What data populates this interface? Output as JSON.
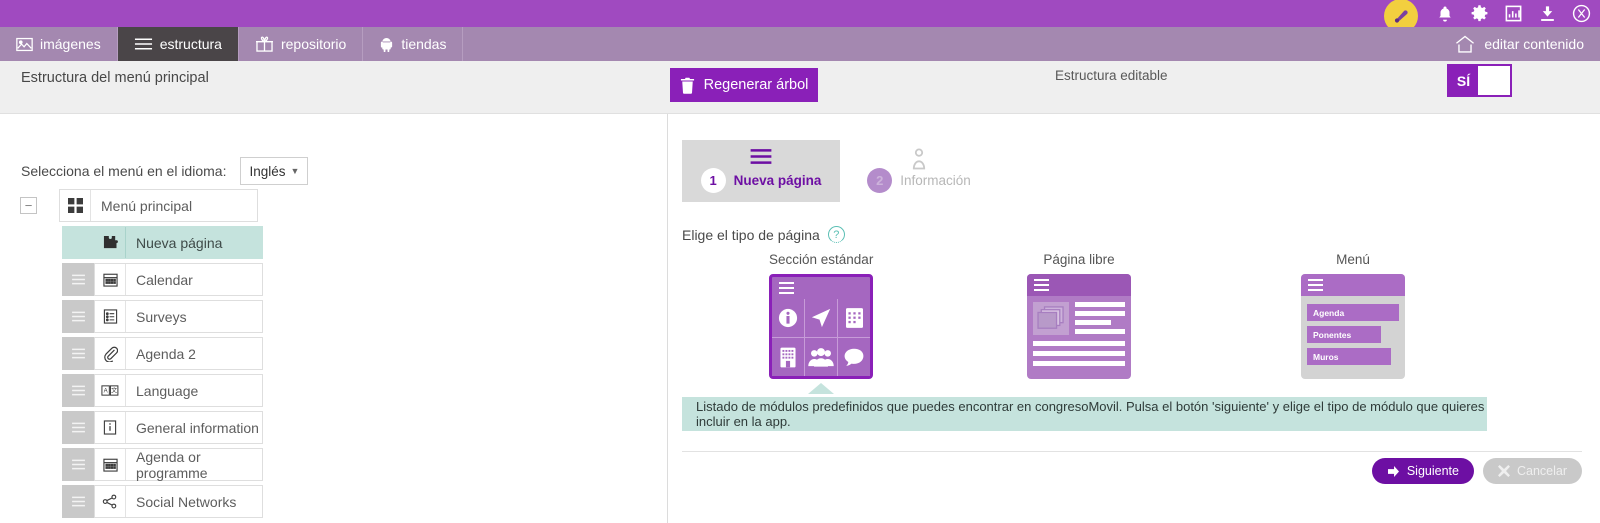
{
  "topbar": {
    "accent_color": "#a04ac0",
    "avatar_color": "#f2cf3f",
    "icons": [
      "avatar-icon",
      "bell-icon",
      "gear-icon",
      "stats-icon",
      "download-icon",
      "android-icon"
    ]
  },
  "nav": {
    "tabs": [
      {
        "label": "imágenes",
        "icon": "image-icon",
        "active": false
      },
      {
        "label": "estructura",
        "icon": "menu-icon",
        "active": true
      },
      {
        "label": "repositorio",
        "icon": "gift-icon",
        "active": false
      },
      {
        "label": "tiendas",
        "icon": "android-icon",
        "active": false
      }
    ],
    "right_link": {
      "label": "editar contenido",
      "icon": "home-icon"
    }
  },
  "subheader": {
    "title": "Estructura del menú principal",
    "regenerate_button": {
      "label": "Regenerar árbol",
      "icon": "trash-icon"
    },
    "editable_label": "Estructura editable",
    "toggle": {
      "value": "SÍ",
      "state": "on"
    }
  },
  "left_panel": {
    "language_label": "Selecciona el menú en el idioma:",
    "language_value": "Inglés",
    "tree": {
      "root": {
        "label": "Menú principal",
        "icon": "grid-icon",
        "collapse": "−"
      },
      "children": [
        {
          "label": "Nueva página",
          "icon": "puzzle-icon",
          "selected": true
        },
        {
          "label": "Calendar",
          "icon": "calendar-icon",
          "selected": false
        },
        {
          "label": "Surveys",
          "icon": "survey-icon",
          "selected": false
        },
        {
          "label": "Agenda 2",
          "icon": "paperclip-icon",
          "selected": false
        },
        {
          "label": "Language",
          "icon": "translate-icon",
          "selected": false
        },
        {
          "label": "General information",
          "icon": "info-icon",
          "selected": false
        },
        {
          "label": "Agenda or programme",
          "icon": "calendar-icon",
          "selected": false
        },
        {
          "label": "Social Networks",
          "icon": "share-icon",
          "selected": false
        }
      ]
    }
  },
  "right_panel": {
    "steps": [
      {
        "num": "1",
        "label": "Nueva página",
        "icon": "menu-icon",
        "active": true
      },
      {
        "num": "2",
        "label": "Información",
        "icon": "info-person-icon",
        "active": false
      }
    ],
    "choose_label": "Elige el tipo de página",
    "help_icon": "?",
    "options": [
      {
        "title": "Sección estándar",
        "selected": true
      },
      {
        "title": "Página libre",
        "selected": false
      },
      {
        "title": "Menú",
        "selected": false
      }
    ],
    "menu_thumb_items": [
      "Agenda",
      "Ponentes",
      "Muros"
    ],
    "tooltip": "Listado de módulos predefinidos que puedes encontrar en congresoMovil. Pulsa el botón 'siguiente' y elige el tipo de módulo que quieres incluir en la app.",
    "buttons": {
      "next": {
        "label": "Siguiente",
        "icon": "arrow-right-icon"
      },
      "cancel": {
        "label": "Cancelar",
        "icon": "close-icon"
      }
    }
  }
}
